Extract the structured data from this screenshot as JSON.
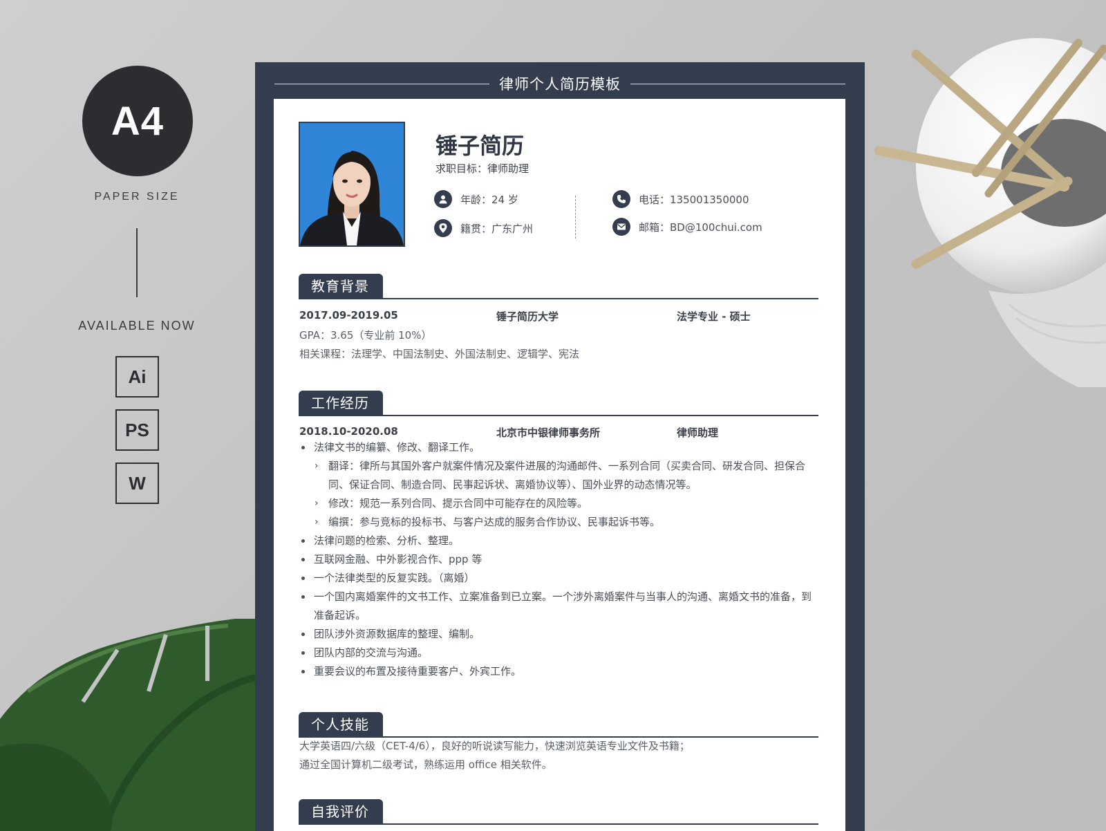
{
  "left_panel": {
    "badge": "A4",
    "paper_size": "PAPER SIZE",
    "available": "AVAILABLE NOW",
    "formats": [
      "Ai",
      "PS",
      "W"
    ]
  },
  "resume": {
    "template_title": "律师个人简历模板",
    "name": "锤子简历",
    "objective": "求职目标：律师助理",
    "info": {
      "age": "年龄：24 岁",
      "hometown": "籍贯：广东广州",
      "phone": "电话：135001350000",
      "email": "邮箱：BD@100chui.com"
    },
    "education": {
      "heading": "教育背景",
      "period": "2017.09-2019.05",
      "school": "锤子简历大学",
      "major": "法学专业 - 硕士",
      "gpa": "GPA：3.65（专业前 10%）",
      "courses": "相关课程：法理学、中国法制史、外国法制史、逻辑学、宪法"
    },
    "work": {
      "heading": "工作经历",
      "period": "2018.10-2020.08",
      "company": "北京市中银律师事务所",
      "role": "律师助理",
      "item1": "法律文书的编纂、修改、翻译工作。",
      "sub1": "翻译：律所与其国外客户就案件情况及案件进展的沟通邮件、一系列合同（买卖合同、研发合同、担保合同、保证合同、制造合同、民事起诉状、离婚协议等）、国外业界的动态情况等。",
      "sub2": "修改：规范一系列合同、提示合同中可能存在的风险等。",
      "sub3": "编撰：参与竞标的投标书、与客户达成的服务合作协议、民事起诉书等。",
      "item2": "法律问题的检索、分析、整理。",
      "item3": "互联网金融、中外影视合作、ppp 等",
      "item4": "一个法律类型的反复实践。（离婚）",
      "item5": "一个国内离婚案件的文书工作、立案准备到已立案。一个涉外离婚案件与当事人的沟通、离婚文书的准备，到准备起诉。",
      "item6": "团队涉外资源数据库的整理、编制。",
      "item7": "团队内部的交流与沟通。",
      "item8": "重要会议的布置及接待重要客户、外宾工作。"
    },
    "skills": {
      "heading": "个人技能",
      "line1": "大学英语四/六级（CET-4/6），良好的听说读写能力，快速浏览英语专业文件及书籍；",
      "line2": "通过全国计算机二级考试，熟练运用 office 相关软件。"
    },
    "self_eval": {
      "heading": "自我评价"
    }
  },
  "colors": {
    "navy": "#333d4e",
    "photo_background": "#2f86d8",
    "page_background": "#c8c8c8"
  }
}
